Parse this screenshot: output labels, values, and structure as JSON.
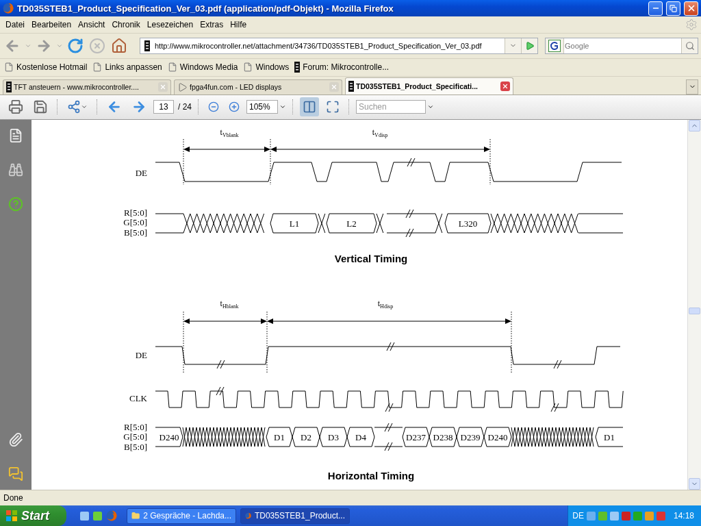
{
  "window": {
    "title": "TD035STEB1_Product_Specification_Ver_03.pdf (application/pdf-Objekt) - Mozilla Firefox"
  },
  "menu": [
    "Datei",
    "Bearbeiten",
    "Ansicht",
    "Chronik",
    "Lesezeichen",
    "Extras",
    "Hilfe"
  ],
  "address": {
    "url": "http://www.mikrocontroller.net/attachment/34736/TD035STEB1_Product_Specification_Ver_03.pdf"
  },
  "search": {
    "placeholder": "Google"
  },
  "bookmarks": [
    {
      "label": "Kostenlose Hotmail",
      "kind": "page"
    },
    {
      "label": "Links anpassen",
      "kind": "page"
    },
    {
      "label": "Windows Media",
      "kind": "page"
    },
    {
      "label": "Windows",
      "kind": "page"
    },
    {
      "label": "Forum: Mikrocontrolle...",
      "kind": "chip"
    }
  ],
  "tabs": [
    {
      "label": "TFT ansteuern - www.mikrocontroller....",
      "kind": "chip",
      "selected": false
    },
    {
      "label": "fpga4fun.com - LED displays",
      "kind": "play",
      "selected": false
    },
    {
      "label": "TD035STEB1_Product_Specificati...",
      "kind": "chip",
      "selected": true
    }
  ],
  "pdf_toolbar": {
    "page": "13",
    "page_count": "/ 24",
    "zoom": "105%",
    "search": {
      "placeholder": "Suchen"
    }
  },
  "document": {
    "diagrams": [
      {
        "kind": "vertical",
        "title": "Vertical Timing",
        "spans": [
          {
            "symbol": "t",
            "subscript": "Vblank"
          },
          {
            "symbol": "t",
            "subscript": "Vdisp"
          }
        ],
        "signals": [
          {
            "kind": "de",
            "label": "DE"
          },
          {
            "kind": "bus",
            "labels": [
              "R[5:0]",
              "G[5:0]",
              "B[5:0]"
            ],
            "cells": [
              "L1",
              "L2",
              "L320"
            ]
          }
        ]
      },
      {
        "kind": "horizontal",
        "title": "Horizontal Timing",
        "spans": [
          {
            "symbol": "t",
            "subscript": "Hblank"
          },
          {
            "symbol": "t",
            "subscript": "Hdisp"
          }
        ],
        "signals": [
          {
            "kind": "de",
            "label": "DE"
          },
          {
            "kind": "clock",
            "label": "CLK"
          },
          {
            "kind": "bus",
            "labels": [
              "R[5:0]",
              "G[5:0]",
              "B[5:0]"
            ],
            "cells": [
              "D240",
              "D1",
              "D2",
              "D3",
              "D4",
              "D237",
              "D238",
              "D239",
              "D240",
              "D1"
            ]
          }
        ]
      }
    ]
  },
  "status_bar": {
    "text": "Done"
  },
  "taskbar": {
    "start": "Start",
    "tasks": [
      {
        "label": "2 Gespräche - Lachda...",
        "kind": "folder",
        "selected": false
      },
      {
        "label": "TD035STEB1_Product...",
        "kind": "browser",
        "selected": true
      }
    ],
    "language": "DE",
    "clock": "14:18"
  }
}
